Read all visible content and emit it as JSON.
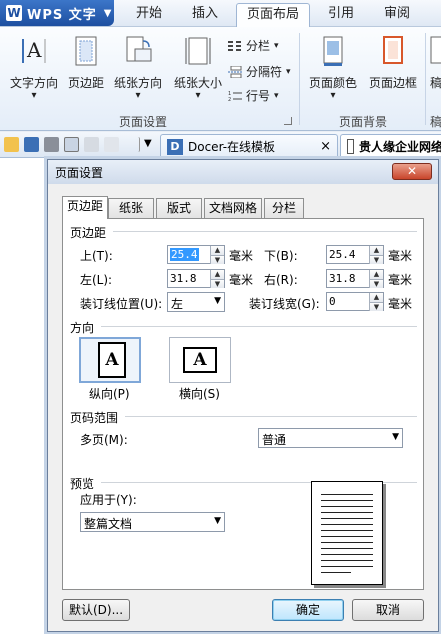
{
  "app": {
    "brand": "WPS 文字",
    "brand_logo": "W",
    "dropdown_glyph": "▼"
  },
  "menu_tabs": [
    {
      "label": "开始"
    },
    {
      "label": "插入"
    },
    {
      "label": "页面布局",
      "active": true
    },
    {
      "label": "引用"
    },
    {
      "label": "审阅"
    }
  ],
  "ribbon": {
    "buttons": [
      {
        "label": "文字方向",
        "arrow": "▾",
        "icon": "text-direction-icon"
      },
      {
        "label": "页边距",
        "icon": "margins-icon"
      },
      {
        "label": "纸张方向",
        "arrow": "▾",
        "icon": "orientation-icon"
      },
      {
        "label": "纸张大小",
        "arrow": "▾",
        "icon": "paper-size-icon"
      },
      {
        "label": "页面颜色",
        "arrow": "▾",
        "icon": "page-color-icon"
      },
      {
        "label": "页面边框",
        "icon": "page-border-icon"
      },
      {
        "label": "稿",
        "icon": "manuscript-icon"
      }
    ],
    "small_items": [
      {
        "label": "分栏",
        "arrow": "▾",
        "icon": "columns-icon"
      },
      {
        "label": "分隔符",
        "arrow": "▾",
        "icon": "separator-icon"
      },
      {
        "label": "行号",
        "arrow": "▾",
        "icon": "line-number-icon"
      }
    ],
    "groups": [
      {
        "label": "页面设置"
      },
      {
        "label": "页面背景"
      },
      {
        "label": "稿"
      }
    ]
  },
  "quickbar": {
    "tabs": [
      {
        "label": "Docer-在线模板",
        "icon": "D",
        "close": "×"
      },
      {
        "label": "贵人缘企业网络",
        "icon": "doc"
      }
    ]
  },
  "dialog": {
    "title": "页面设置",
    "close_glyph": "✕",
    "tabs": [
      {
        "label": "页边距",
        "active": true
      },
      {
        "label": "纸张"
      },
      {
        "label": "版式"
      },
      {
        "label": "文档网格"
      },
      {
        "label": "分栏"
      }
    ],
    "margins": {
      "section_title": "页边距",
      "top_label": "上(T):",
      "top_value": "25.4",
      "bottom_label": "下(B):",
      "bottom_value": "25.4",
      "left_label": "左(L):",
      "left_value": "31.8",
      "right_label": "右(R):",
      "right_value": "31.8",
      "unit": "毫米",
      "gutter_pos_label": "装订线位置(U):",
      "gutter_pos_value": "左",
      "gutter_width_label": "装订线宽(G):",
      "gutter_width_value": "0"
    },
    "orientation": {
      "section_title": "方向",
      "portrait_label": "纵向(P)",
      "landscape_label": "横向(S)",
      "glyph": "A",
      "selected": "portrait"
    },
    "page_range": {
      "section_title": "页码范围",
      "multi_label": "多页(M):",
      "multi_value": "普通"
    },
    "preview": {
      "section_title": "预览",
      "apply_label": "应用于(Y):",
      "apply_value": "整篇文档"
    },
    "buttons": {
      "default": "默认(D)...",
      "ok": "确定",
      "cancel": "取消"
    },
    "spin_up": "▲",
    "spin_down": "▼",
    "combo_arrow": "▼"
  }
}
